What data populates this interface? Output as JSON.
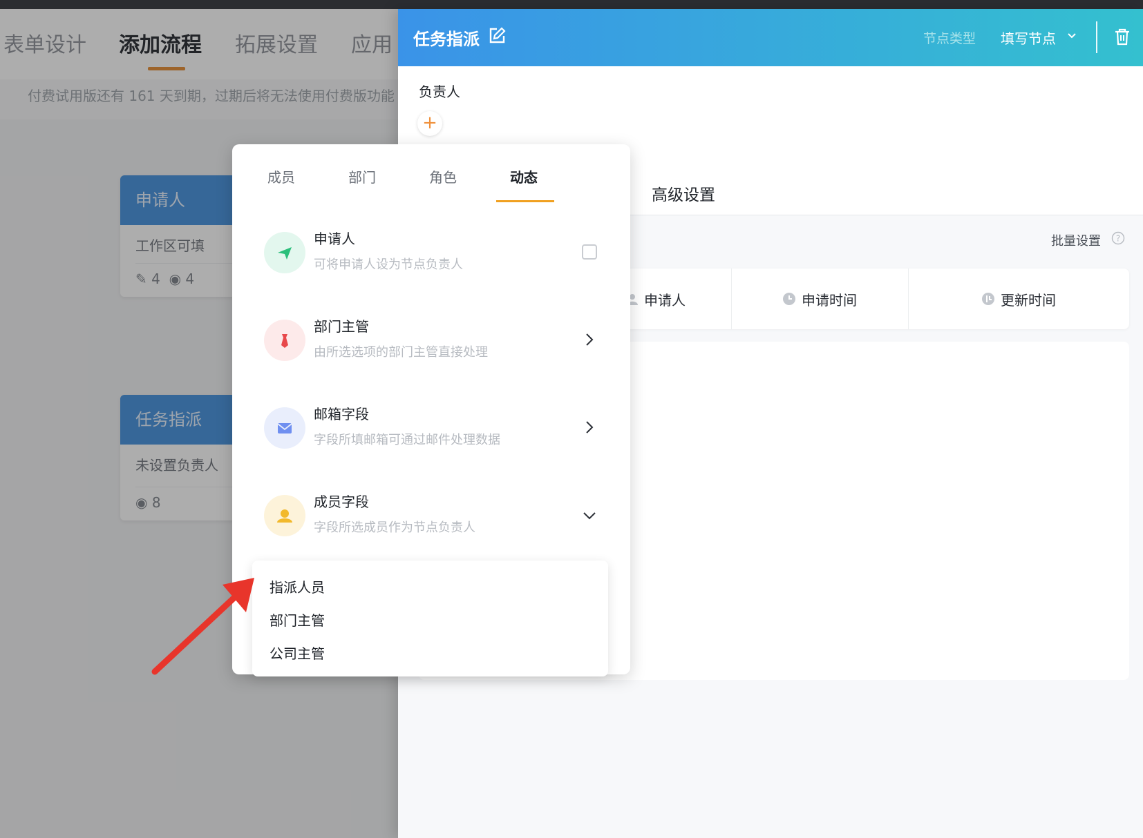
{
  "background": {
    "tabs": [
      {
        "label": "表单设计"
      },
      {
        "label": "添加流程"
      },
      {
        "label": "拓展设置"
      },
      {
        "label": "应用"
      }
    ],
    "notice": "付费试用版还有 161 天到期，过期后将无法使用付费版功能",
    "cards": [
      {
        "title": "申请人",
        "body": "工作区可填",
        "edit_count": "4",
        "view_count": "4"
      },
      {
        "title": "任务指派",
        "body": "未设置负责人",
        "view_count": "8"
      }
    ]
  },
  "drawer": {
    "title": "任务指派",
    "node_type_label": "节点类型",
    "node_type_value": "填写节点",
    "owner_label": "负责人",
    "add_symbol": "+",
    "advanced_tab": "高级设置",
    "batch_label": "批量设置",
    "fields": [
      {
        "label": "申请人"
      },
      {
        "label": "申请时间"
      },
      {
        "label": "更新时间"
      }
    ]
  },
  "popover": {
    "tabs": [
      {
        "label": "成员"
      },
      {
        "label": "部门"
      },
      {
        "label": "角色"
      },
      {
        "label": "动态"
      }
    ],
    "options": [
      {
        "title": "申请人",
        "desc": "可将申请人设为节点负责人"
      },
      {
        "title": "部门主管",
        "desc": "由所选选项的部门主管直接处理"
      },
      {
        "title": "邮箱字段",
        "desc": "字段所填邮箱可通过邮件处理数据"
      },
      {
        "title": "成员字段",
        "desc": "字段所选成员作为节点负责人"
      }
    ],
    "submenu": [
      {
        "label": "指派人员"
      },
      {
        "label": "部门主管"
      },
      {
        "label": "公司主管"
      }
    ]
  },
  "colors": {
    "accent_orange": "#f0a020",
    "header_gradient_start": "#3a93e8",
    "header_gradient_end": "#34c0cf",
    "annotation_arrow": "#e8352b"
  }
}
